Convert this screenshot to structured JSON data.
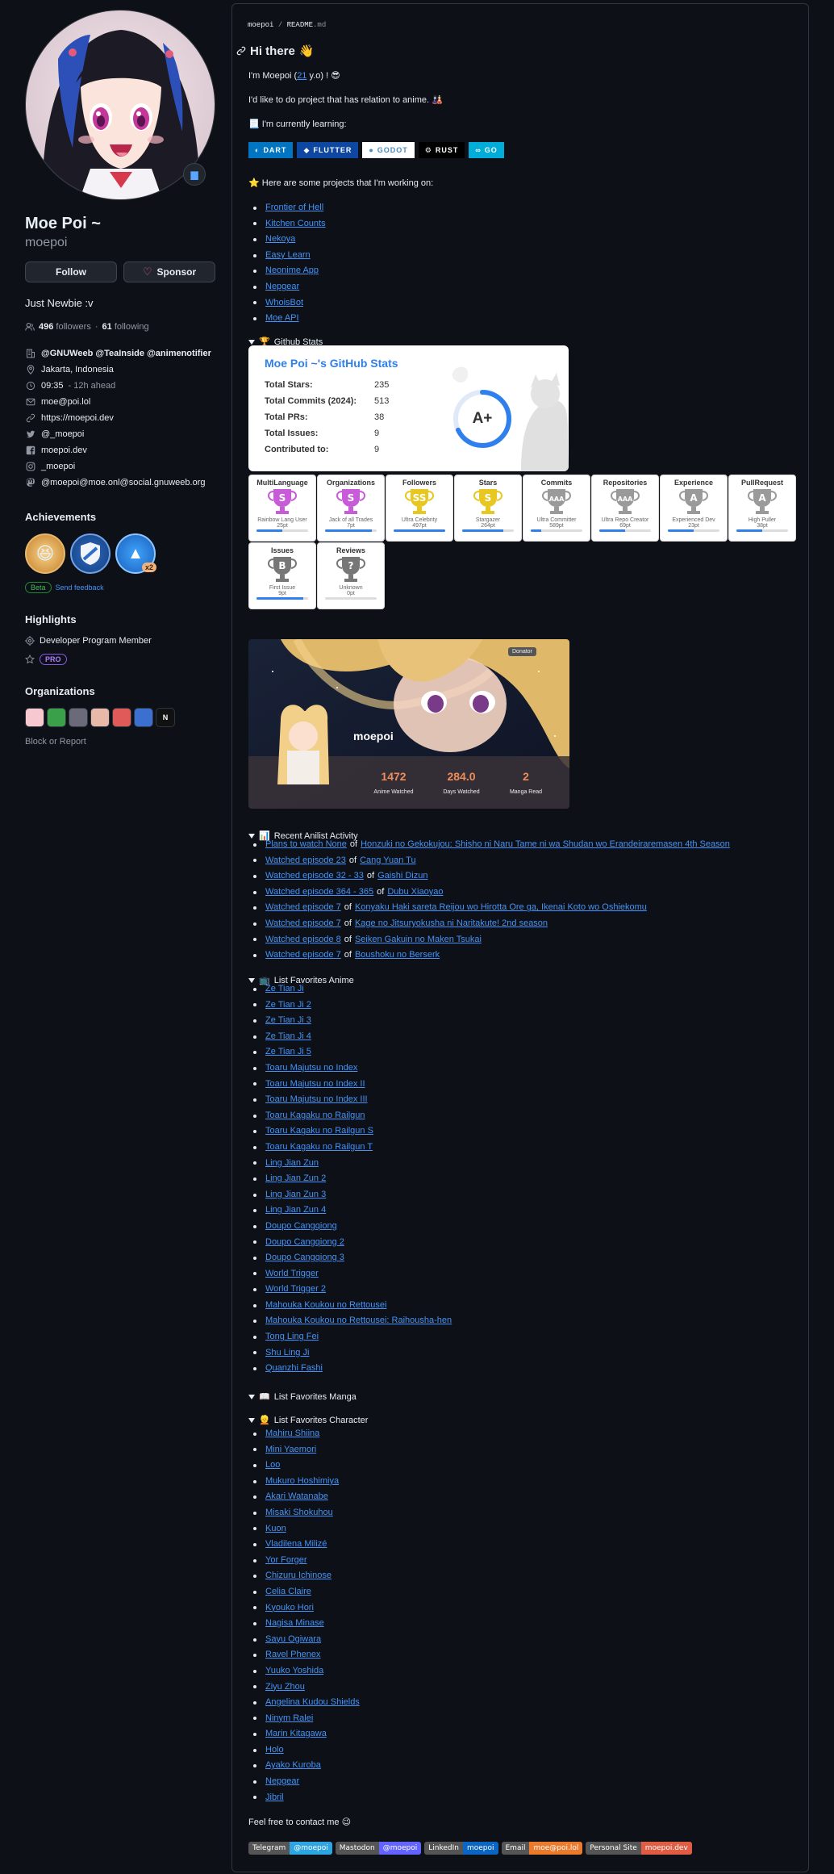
{
  "profile": {
    "fullname": "Moe Poi ~",
    "username": "moepoi",
    "follow_label": "Follow",
    "sponsor_label": "Sponsor",
    "bio": "Just Newbie :v",
    "followers": "496",
    "followers_label": "followers",
    "following": "61",
    "following_label": "following",
    "org_line": "@GNUWeeb @TeaInside @animenotifier",
    "location": "Jakarta, Indonesia",
    "time": "09:35",
    "time_note": "- 12h ahead",
    "email": "moe@poi.lol",
    "website": "https://moepoi.dev",
    "twitter": "@_moepoi",
    "facebook": "moepoi.dev",
    "instagram": "_moepoi",
    "mastodon": "@moepoi@moe.onl@social.gnuweeb.org"
  },
  "achievements": {
    "heading": "Achievements",
    "multiplier": "x2",
    "beta": "Beta",
    "feedback": "Send feedback"
  },
  "highlights": {
    "heading": "Highlights",
    "item": "Developer Program Member",
    "pro": "PRO"
  },
  "organizations": {
    "heading": "Organizations",
    "block_report": "Block or Report",
    "colors": [
      "#f8c8d0",
      "#3aa04a",
      "#6a6a7a",
      "#e8b8a8",
      "#e05a5a",
      "#3b6fd0",
      "#111111"
    ]
  },
  "readme": {
    "path_user": "moepoi",
    "path_sep": "/",
    "path_file": "README",
    "path_ext": ".md",
    "greeting": "Hi there",
    "wave": "👋",
    "intro_a": "I'm Moepoi (",
    "intro_age": "21",
    "intro_b": " y.o) !",
    "intro_emoji": "😎",
    "intro2": "I'd like to do project that has relation to anime.",
    "intro2_emoji": "🎎",
    "learning": "I'm currently learning:",
    "learning_emoji": "📃",
    "badges": [
      {
        "label": "DART",
        "icon": "◐",
        "bg": "#0175c2",
        "fg": "#ffffff"
      },
      {
        "label": "FLUTTER",
        "icon": "◆",
        "bg": "#0d47a1",
        "fg": "#ffffff"
      },
      {
        "label": "GODOT",
        "icon": "●",
        "bg": "#ffffff",
        "fg": "#478cbf"
      },
      {
        "label": "RUST",
        "icon": "⚙",
        "bg": "#000000",
        "fg": "#ffffff"
      },
      {
        "label": "GO",
        "icon": "∞",
        "bg": "#00add8",
        "fg": "#ffffff"
      }
    ],
    "projects_intro": "Here are some projects that I'm working on:",
    "projects_emoji": "⭐",
    "projects": [
      "Frontier of Hell",
      "Kitchen Counts",
      "Nekoya",
      "Easy Learn",
      "Neonime App",
      "Nepgear",
      "WhoisBot",
      "Moe API"
    ],
    "github_stats_label": "Github Stats",
    "github_stats_emoji": "🏆"
  },
  "stats_card": {
    "title": "Moe Poi ~'s GitHub Stats",
    "rows": [
      {
        "k": "Total Stars:",
        "v": "235"
      },
      {
        "k": "Total Commits (2024):",
        "v": "513"
      },
      {
        "k": "Total PRs:",
        "v": "38"
      },
      {
        "k": "Total Issues:",
        "v": "9"
      },
      {
        "k": "Contributed to:",
        "v": "9"
      }
    ],
    "grade": "A+",
    "progress": 0.68
  },
  "trophies": [
    {
      "title": "MultiLanguage",
      "grade": "S",
      "rank": "Rainbow Lang User",
      "pts": "25pt",
      "color": "#c85bd8",
      "progress": 0.5
    },
    {
      "title": "Organizations",
      "grade": "S",
      "rank": "Jack of all Trades",
      "pts": "7pt",
      "color": "#c85bd8",
      "progress": 0.9
    },
    {
      "title": "Followers",
      "grade": "SS",
      "rank": "Ultra Celebrity",
      "pts": "497pt",
      "color": "#e8c820",
      "progress": 1.0
    },
    {
      "title": "Stars",
      "grade": "S",
      "rank": "Stargazer",
      "pts": "264pt",
      "color": "#e8c820",
      "progress": 0.8
    },
    {
      "title": "Commits",
      "grade": "AAA",
      "rank": "Ultra Committer",
      "pts": "589pt",
      "color": "#9a9a9a",
      "progress": 0.2
    },
    {
      "title": "Repositories",
      "grade": "AAA",
      "rank": "Ultra Repo Creator",
      "pts": "69pt",
      "color": "#9a9a9a",
      "progress": 0.5
    },
    {
      "title": "Experience",
      "grade": "A",
      "rank": "Experienced Dev",
      "pts": "23pt",
      "color": "#9a9a9a",
      "progress": 0.5
    },
    {
      "title": "PullRequest",
      "grade": "A",
      "rank": "High Puller",
      "pts": "38pt",
      "color": "#9a9a9a",
      "progress": 0.5
    },
    {
      "title": "Issues",
      "grade": "B",
      "rank": "First Issue",
      "pts": "9pt",
      "color": "#777777",
      "progress": 0.9
    },
    {
      "title": "Reviews",
      "grade": "?",
      "rank": "Unknown",
      "pts": "0pt",
      "color": "#777777",
      "progress": 0.0
    }
  ],
  "anime_card": {
    "name": "moepoi",
    "donator": "Donator",
    "stats": [
      {
        "value": "1472",
        "label": "Anime Watched"
      },
      {
        "value": "284.0",
        "label": "Days Watched"
      },
      {
        "value": "2",
        "label": "Manga Read"
      }
    ]
  },
  "anilist": {
    "heading": "Recent Anilist Activity",
    "emoji": "📊",
    "of": "of",
    "items": [
      {
        "action": "Plans to watch None",
        "title": "Honzuki no Gekokujou: Shisho ni Naru Tame ni wa Shudan wo Erandeiraremasen 4th Season"
      },
      {
        "action": "Watched episode 23",
        "title": "Cang Yuan Tu"
      },
      {
        "action": "Watched episode 32 - 33",
        "title": "Gaishi Dizun"
      },
      {
        "action": "Watched episode 364 - 365",
        "title": "Dubu Xiaoyao"
      },
      {
        "action": "Watched episode 7",
        "title": "Konyaku Haki sareta Reijou wo Hirotta Ore ga, Ikenai Koto wo Oshiekomu"
      },
      {
        "action": "Watched episode 7",
        "title": "Kage no Jitsuryokusha ni Naritakute! 2nd season"
      },
      {
        "action": "Watched episode 8",
        "title": "Seiken Gakuin no Maken Tsukai"
      },
      {
        "action": "Watched episode 7",
        "title": "Boushoku no Berserk"
      }
    ]
  },
  "fav_anime": {
    "heading": "List Favorites Anime",
    "emoji": "📺",
    "items": [
      "Ze Tian Ji",
      "Ze Tian Ji 2",
      "Ze Tian Ji 3",
      "Ze Tian Ji 4",
      "Ze Tian Ji 5",
      "Toaru Majutsu no Index",
      "Toaru Majutsu no Index II",
      "Toaru Majutsu no Index III",
      "Toaru Kagaku no Railgun",
      "Toaru Kagaku no Railgun S",
      "Toaru Kagaku no Railgun T",
      "Ling Jian Zun",
      "Ling Jian Zun 2",
      "Ling Jian Zun 3",
      "Ling Jian Zun 4",
      "Doupo Cangqiong",
      "Doupo Cangqiong 2",
      "Doupo Cangqiong 3",
      "World Trigger",
      "World Trigger 2",
      "Mahouka Koukou no Rettousei",
      "Mahouka Koukou no Rettousei: Raihousha-hen",
      "Tong Ling Fei",
      "Shu Ling Ji",
      "Quanzhi Fashi"
    ]
  },
  "fav_manga": {
    "heading": "List Favorites Manga",
    "emoji": "📖"
  },
  "fav_char": {
    "heading": "List Favorites Character",
    "emoji": "👱",
    "items": [
      "Mahiru Shiina",
      "Mini Yaemori",
      "Loo",
      "Mukuro Hoshimiya",
      "Akari Watanabe",
      "Misaki Shokuhou",
      "Kuon",
      "Vladilena Milizé",
      "Yor Forger",
      "Chizuru Ichinose",
      "Celia Claire",
      "Kyouko Hori",
      "Nagisa Minase",
      "Sayu Ogiwara",
      "Ravel Phenex",
      "Yuuko Yoshida",
      "Ziyu Zhou",
      "Angelina Kudou Shields",
      "Ninym Ralei",
      "Marin Kitagawa",
      "Holo",
      "Ayako Kuroba",
      "Nepgear",
      "Jibril"
    ]
  },
  "contact": {
    "text": "Feel free to contact me",
    "emoji": "😉",
    "badges": [
      {
        "l": "Telegram",
        "r": "@moepoi",
        "color": "#2ca5e0"
      },
      {
        "l": "Mastodon",
        "r": "@moepoi",
        "color": "#6364ff"
      },
      {
        "l": "LinkedIn",
        "r": "moepoi",
        "color": "#0a66c2"
      },
      {
        "l": "Email",
        "r": "moe@poi.lol",
        "color": "#ea7a2c"
      },
      {
        "l": "Personal Site",
        "r": "moepoi.dev",
        "color": "#e05d44"
      }
    ]
  }
}
